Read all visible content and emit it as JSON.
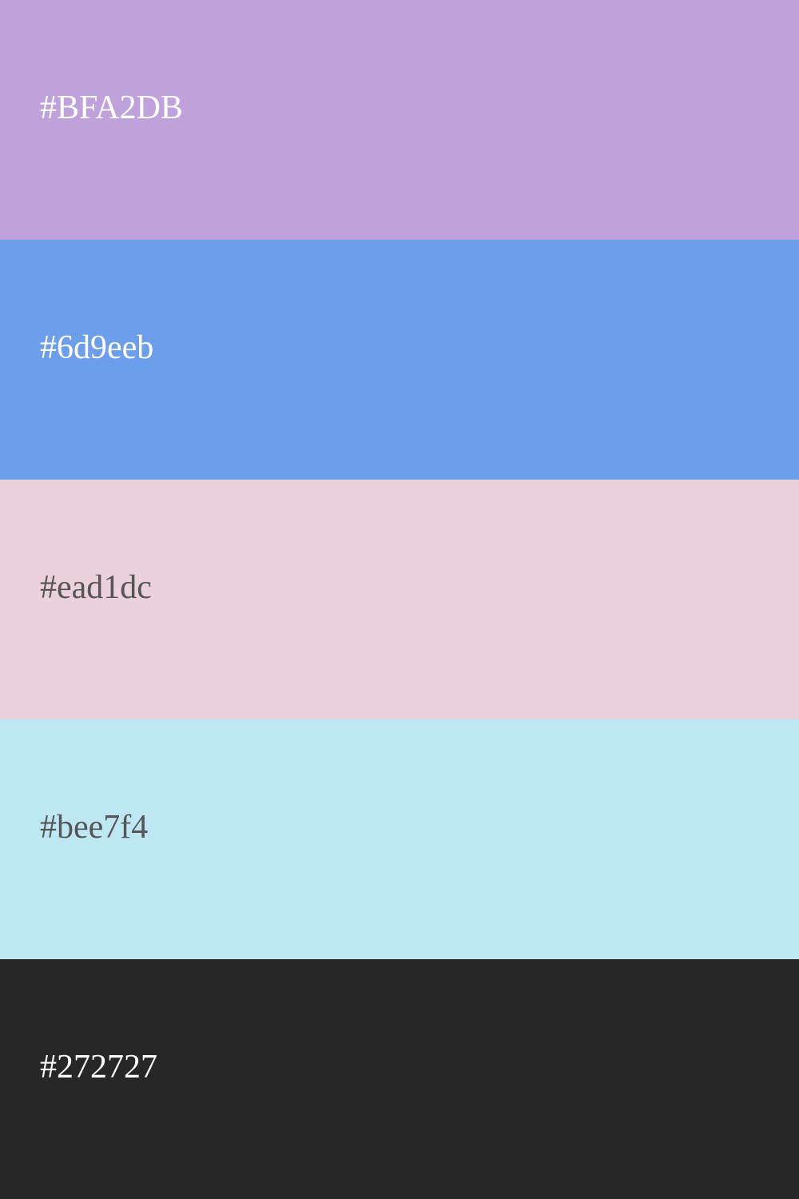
{
  "swatches": [
    {
      "label": "#BFA2DB",
      "color": "#BFA2DB",
      "text_color": "#ffffff"
    },
    {
      "label": "#6d9eeb",
      "color": "#6d9eeb",
      "text_color": "#ffffff"
    },
    {
      "label": "#ead1dc",
      "color": "#ead1dc",
      "text_color": "#555555"
    },
    {
      "label": "#bee7f4",
      "color": "#bee7f4",
      "text_color": "#555555"
    },
    {
      "label": "#272727",
      "color": "#272727",
      "text_color": "#ffffff"
    }
  ]
}
